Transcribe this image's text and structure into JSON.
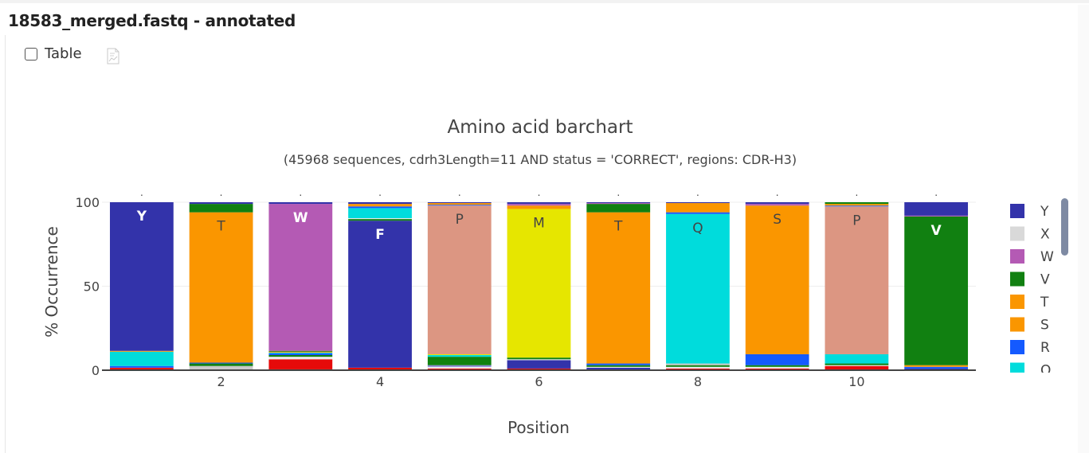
{
  "header": {
    "title": "18583_merged.fastq - annotated"
  },
  "toolbar": {
    "table_label": "Table",
    "table_checked": false,
    "export_icon": "chart-export-icon"
  },
  "chart_data": {
    "type": "bar",
    "stacked": true,
    "title": "Amino acid barchart",
    "subtitle": "(45968 sequences, cdrh3Length=11 AND status = 'CORRECT', regions: CDR-H3)",
    "xlabel": "Position",
    "ylabel": "% Occurrence",
    "ylim": [
      0,
      100
    ],
    "yticks": [
      0,
      50,
      100
    ],
    "xticks": [
      2,
      4,
      6,
      8,
      10
    ],
    "categories": [
      1,
      2,
      3,
      4,
      5,
      6,
      7,
      8,
      9,
      10,
      11
    ],
    "grid": true,
    "legend_position": "right",
    "colors": {
      "Y": "#3333aa",
      "F": "#3333aa",
      "X": "#d9d9d9",
      "W": "#b45ab4",
      "V": "#118011",
      "T": "#fa9600",
      "S": "#fa9600",
      "R": "#145aff",
      "Q": "#00dcdc",
      "N": "#00dcdc",
      "P": "#dc9682",
      "M": "#e6e600",
      "L": "#0f820f",
      "K": "#145aff",
      "I": "#0f820f",
      "H": "#8282d2",
      "G": "#ebebeb",
      "E": "#e60a0a",
      "D": "#e60a0a",
      "C": "#e6e600",
      "A": "#c8c8c8"
    },
    "stacks": [
      {
        "position": 1,
        "dominant": "Y",
        "segments": [
          [
            "D",
            1
          ],
          [
            "E",
            0.5
          ],
          [
            "R",
            1
          ],
          [
            "N",
            8.5
          ],
          [
            "T",
            0.5
          ],
          [
            "Y",
            88.5
          ]
        ]
      },
      {
        "position": 2,
        "dominant": "T",
        "segments": [
          [
            "A",
            2.5
          ],
          [
            "V",
            1.5
          ],
          [
            "R",
            0.5
          ],
          [
            "T",
            89.5
          ],
          [
            "V",
            5
          ],
          [
            "Y",
            1
          ]
        ]
      },
      {
        "position": 3,
        "dominant": "W",
        "segments": [
          [
            "C",
            0.5
          ],
          [
            "D",
            6
          ],
          [
            "G",
            1.5
          ],
          [
            "L",
            1
          ],
          [
            "R",
            1
          ],
          [
            "Q",
            0.5
          ],
          [
            "S",
            0.5
          ],
          [
            "V",
            0.5
          ],
          [
            "W",
            87.5
          ],
          [
            "Y",
            1
          ]
        ]
      },
      {
        "position": 4,
        "dominant": "F",
        "segments": [
          [
            "D",
            1.5
          ],
          [
            "F",
            87.5
          ],
          [
            "V",
            1
          ],
          [
            "G",
            0.5
          ],
          [
            "Q",
            6
          ],
          [
            "R",
            1
          ],
          [
            "T",
            1.5
          ],
          [
            "Y",
            1
          ]
        ]
      },
      {
        "position": 5,
        "dominant": "P",
        "segments": [
          [
            "D",
            1
          ],
          [
            "G",
            1
          ],
          [
            "H",
            1
          ],
          [
            "L",
            5
          ],
          [
            "Q",
            1
          ],
          [
            "C",
            0.5
          ],
          [
            "P",
            88.5
          ],
          [
            "R",
            0.5
          ],
          [
            "S",
            1
          ],
          [
            "Y",
            0.5
          ]
        ]
      },
      {
        "position": 6,
        "dominant": "M",
        "segments": [
          [
            "D",
            1
          ],
          [
            "F",
            5
          ],
          [
            "G",
            0.5
          ],
          [
            "V",
            1
          ],
          [
            "M",
            88.5
          ],
          [
            "S",
            2
          ],
          [
            "W",
            1
          ],
          [
            "Y",
            1
          ]
        ]
      },
      {
        "position": 7,
        "dominant": "T",
        "segments": [
          [
            "Y",
            1.5
          ],
          [
            "G",
            0.5
          ],
          [
            "V",
            1
          ],
          [
            "R",
            1
          ],
          [
            "T",
            90
          ],
          [
            "V",
            5
          ],
          [
            "W",
            0.5
          ],
          [
            "Y",
            0.5
          ]
        ]
      },
      {
        "position": 8,
        "dominant": "Q",
        "segments": [
          [
            "D",
            1
          ],
          [
            "G",
            1
          ],
          [
            "L",
            1
          ],
          [
            "A",
            1
          ],
          [
            "Q",
            89
          ],
          [
            "R",
            1
          ],
          [
            "S",
            5.5
          ],
          [
            "Y",
            0.5
          ]
        ]
      },
      {
        "position": 9,
        "dominant": "S",
        "segments": [
          [
            "D",
            1
          ],
          [
            "G",
            1
          ],
          [
            "L",
            1
          ],
          [
            "R",
            6.5
          ],
          [
            "S",
            88.5
          ],
          [
            "W",
            1
          ],
          [
            "Y",
            1
          ]
        ]
      },
      {
        "position": 10,
        "dominant": "P",
        "segments": [
          [
            "D",
            2.5
          ],
          [
            "G",
            0.5
          ],
          [
            "L",
            1
          ],
          [
            "Q",
            5.5
          ],
          [
            "P",
            88
          ],
          [
            "R",
            0.5
          ],
          [
            "S",
            1
          ],
          [
            "V",
            1
          ]
        ]
      },
      {
        "position": 11,
        "dominant": "V",
        "segments": [
          [
            "Y",
            1
          ],
          [
            "R",
            1
          ],
          [
            "S",
            1
          ],
          [
            "V",
            88.5
          ],
          [
            "W",
            0.5
          ],
          [
            "Y",
            8
          ]
        ]
      }
    ]
  },
  "legend": {
    "items": [
      {
        "label": "Y",
        "color": "#3333aa"
      },
      {
        "label": "X",
        "color": "#d9d9d9"
      },
      {
        "label": "W",
        "color": "#b45ab4"
      },
      {
        "label": "V",
        "color": "#118011"
      },
      {
        "label": "T",
        "color": "#fa9600"
      },
      {
        "label": "S",
        "color": "#fa9600"
      },
      {
        "label": "R",
        "color": "#145aff"
      },
      {
        "label": "Q",
        "color": "#00dcdc"
      }
    ]
  }
}
